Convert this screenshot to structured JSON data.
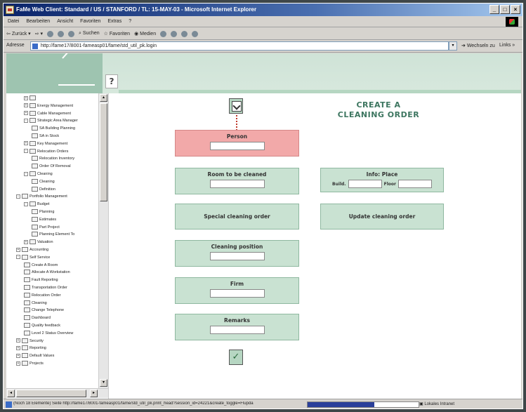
{
  "window": {
    "title": "FaMe Web Client: Standard / US / STANFORD / TL: 15-MAY-03 - Microsoft Internet Explorer",
    "buttons": {
      "minimize": "_",
      "maximize": "□",
      "close": "×"
    }
  },
  "menu": [
    "Datei",
    "Bearbeiten",
    "Ansicht",
    "Favoriten",
    "Extras",
    "?"
  ],
  "toolbar": {
    "back": "Zurück",
    "search": "Suchen",
    "favorites": "Favoriten",
    "media": "Medien"
  },
  "address": {
    "label": "Adresse",
    "url": "http://fame17/8001-fameasp01/fame/std_util_pk.login",
    "go": "Wechseln zu",
    "links": "Links"
  },
  "help": {
    "label": "?"
  },
  "tree": [
    {
      "label": "",
      "level": 1,
      "exp": "+"
    },
    {
      "label": "Energy Management",
      "level": 1,
      "exp": "+"
    },
    {
      "label": "Cable Management",
      "level": 1,
      "exp": "+"
    },
    {
      "label": "Strategic Area Manager",
      "level": 1,
      "exp": "-"
    },
    {
      "label": "SA Building Planning",
      "level": 2,
      "exp": ""
    },
    {
      "label": "SA in Stock",
      "level": 2,
      "exp": ""
    },
    {
      "label": "Key Management",
      "level": 1,
      "exp": "+"
    },
    {
      "label": "Relocation Orders",
      "level": 1,
      "exp": "-"
    },
    {
      "label": "Relocation Inventory",
      "level": 2,
      "exp": ""
    },
    {
      "label": "Order Of Removal",
      "level": 2,
      "exp": ""
    },
    {
      "label": "Cleaning",
      "level": 1,
      "exp": "-"
    },
    {
      "label": "Cleaning",
      "level": 2,
      "exp": ""
    },
    {
      "label": "Definition",
      "level": 2,
      "exp": ""
    },
    {
      "label": "Portfolio Management",
      "level": 0,
      "exp": "-"
    },
    {
      "label": "Budget",
      "level": 1,
      "exp": "-"
    },
    {
      "label": "Planning",
      "level": 2,
      "exp": ""
    },
    {
      "label": "Estimates",
      "level": 2,
      "exp": ""
    },
    {
      "label": "Part Project",
      "level": 2,
      "exp": ""
    },
    {
      "label": "Planning Element To",
      "level": 2,
      "exp": ""
    },
    {
      "label": "Valuation",
      "level": 1,
      "exp": "+"
    },
    {
      "label": "Accounting",
      "level": 0,
      "exp": "+"
    },
    {
      "label": "Self Service",
      "level": 0,
      "exp": "-"
    },
    {
      "label": "Create A Room",
      "level": 1,
      "exp": ""
    },
    {
      "label": "Allocate A Workstation",
      "level": 1,
      "exp": ""
    },
    {
      "label": "Fault Reporting",
      "level": 1,
      "exp": ""
    },
    {
      "label": "Transportation Order",
      "level": 1,
      "exp": ""
    },
    {
      "label": "Relocation Order",
      "level": 1,
      "exp": ""
    },
    {
      "label": "Cleaning",
      "level": 1,
      "exp": ""
    },
    {
      "label": "Change Telephone",
      "level": 1,
      "exp": ""
    },
    {
      "label": "Dashboard",
      "level": 1,
      "exp": ""
    },
    {
      "label": "Quality feedback",
      "level": 1,
      "exp": ""
    },
    {
      "label": "Level 2 Status Overview",
      "level": 1,
      "exp": ""
    },
    {
      "label": "Security",
      "level": 0,
      "exp": "+"
    },
    {
      "label": "Reporting",
      "level": 0,
      "exp": "+"
    },
    {
      "label": "Default Values",
      "level": 0,
      "exp": "+"
    },
    {
      "label": "Projects",
      "level": 0,
      "exp": "+"
    }
  ],
  "form": {
    "title_line1": "CREATE A",
    "title_line2": "CLEANING ORDER",
    "person_label": "Person",
    "room_label": "Room to be cleaned",
    "info_label": "Info: Place",
    "build_label": "Build.",
    "floor_label": "Floor",
    "special_label": "Special cleaning order",
    "update_label": "Update cleaning order",
    "position_label": "Cleaning position",
    "firm_label": "Firm",
    "remarks_label": "Remarks",
    "ok_symbol": "✓"
  },
  "status": {
    "text": "(Noch 18 Elemente) Seite http://fame17/8001-fameasp01/fame/std_util_pk.print_head?session_id=24221&create_toggle=Flupda",
    "zone": "Lokales Intranet",
    "progress": 0.6
  },
  "colors": {
    "accent_green": "#3d7660",
    "box_green": "#c9e2d2",
    "box_pink": "#f2a9a9"
  }
}
